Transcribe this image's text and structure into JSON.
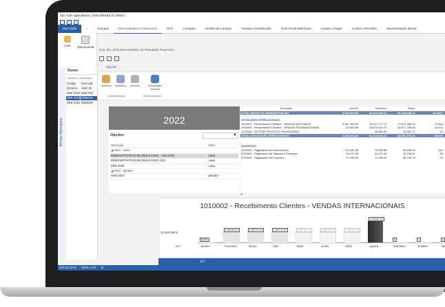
{
  "window": {
    "title": "Ster Soft Applications ( 2022.000165 11.00924 )"
  },
  "menu": {
    "tabs": [
      "SSA 2022",
      "Estoque",
      "Demonstrativos Financeiros",
      "PCP",
      "Compras",
      "Gestão de Cotação",
      "Vendas e Distribuição",
      "Nota Fiscal Eletrônica",
      "Contas a Pagar",
      "Contas a Receber",
      "Movimentação Bancá"
    ],
    "active_index": 2
  },
  "left_ribbon": {
    "livre": "Livre",
    "operacional": "Operacional"
  },
  "navigator": {
    "vertical_label": "Minhas Aplicações",
    "header": "Demo",
    "drag_hint": "Arraste o cabeçalho",
    "columns": [
      "Código",
      "Descriçã"
    ],
    "rows": [
      {
        "code": "2019/AA",
        "desc": "ANO 20"
      },
      {
        "code": "DRE 2020",
        "desc": "DRE 202"
      },
      {
        "code": "DRE 2021",
        "desc": "DEMONI"
      },
      {
        "code": "DRE 2022",
        "desc": "DEMONI"
      }
    ],
    "selected_index": 2
  },
  "document": {
    "title": "[ssa_dre_001]  Demonstrativo de Resultado Financeiro",
    "ribbon_tab": "Opções",
    "buttons": [
      {
        "label": "Acessos",
        "color": "#d9a64a"
      },
      {
        "label": "Histórico",
        "color": "#8aa4cf"
      },
      {
        "label": "Anexos",
        "color": "#b0b0b0"
      },
      {
        "label": "Informação Técnica",
        "color": "#4d7bc6"
      }
    ],
    "groups": [
      "Administração",
      "Desenvolvedor"
    ]
  },
  "year_panel": {
    "year": "2022"
  },
  "opcoes": {
    "title": "Opções",
    "columns": [
      "Descrição",
      "Fator"
    ],
    "groups": [
      {
        "label": "◢  Fator : caixa",
        "rows": [
          {
            "desc": "DEMONSTRATIVO DE RESULTADO - ANO 2022",
            "fator": "caixa"
          },
          {
            "desc": "DEMONSTRATIVO DE RESULTADO 2021",
            "fator": "caixa"
          },
          {
            "desc": "DRE 2020",
            "fator": "caixa"
          }
        ]
      },
      {
        "label": "◢  Fator : gerador",
        "rows": [
          {
            "desc": "ANO 2019",
            "fator": "gerador"
          }
        ]
      }
    ]
  },
  "report": {
    "columns": [
      "Descrição",
      "Janeiro",
      "Fevereiro",
      "Março",
      ""
    ],
    "rows": [
      {
        "type": "total",
        "cells": [
          "TOTAL RECEITAS DEMONSTRAÇÃO",
          "3.436.923,96",
          "92.610.903,11",
          "89.283.638,76",
          "89.260.7"
        ]
      },
      {
        "type": "blank",
        "cells": [
          "",
          "",
          "",
          "",
          ""
        ]
      },
      {
        "type": "sect",
        "cells": [
          "ATIVIDADES OPERACIONAIS",
          "",
          "",
          "",
          ""
        ]
      },
      {
        "type": "row",
        "cells": [
          "1010001 - Recebimento Clientes - VENDAS NACIONAIS",
          "3.357.490,00",
          "76.007.277,74",
          "72.674.288,39",
          "72.654."
        ]
      },
      {
        "type": "row",
        "cells": [
          "1010002 - Recebimento Clientes - VENDAS INTERNACIONAIS",
          "62.063,96",
          "16.574.031,97",
          "16.577.798,68",
          "16.574."
        ]
      },
      {
        "type": "row",
        "cells": [
          "1010005 - OUTRAS RECEITAS FINANCEIRAS",
          "",
          "35.363,40",
          "14.081,70",
          "14."
        ]
      },
      {
        "type": "total",
        "cells": [
          "TOTAL ATIVIDADES OPERACIONAIS",
          "3.420.263,96",
          "92.616.603,11",
          "89.266.978,76",
          "89.243."
        ]
      },
      {
        "type": "blank",
        "cells": [
          "",
          "",
          "",
          "",
          ""
        ]
      },
      {
        "type": "blank",
        "cells": [
          "",
          "",
          "",
          "",
          ""
        ]
      },
      {
        "type": "sect",
        "cells": [
          "DESPESAS",
          "",
          "",
          "",
          ""
        ]
      },
      {
        "type": "row",
        "cells": [
          "2010001 - Pagamento a Fornecedores",
          "175.181,48",
          "73.468,99",
          "43.636,93",
          "164."
        ]
      },
      {
        "type": "row",
        "cells": [
          "2010002 - Pagamento de Salários e Encargos",
          "54.471,48",
          "54.471,48",
          "78.608,87",
          "66."
        ]
      },
      {
        "type": "row",
        "cells": [
          "2010003 - Pagamento de Impostos",
          "71.189,03",
          "71.189,03",
          "36.736,78",
          "12."
        ]
      }
    ]
  },
  "chart_data": {
    "type": "bar",
    "title": "1010002 - Recebimento Clientes - VENDAS INTERNACIONAIS",
    "categories": [
      "Janeiro",
      "Fevereiro",
      "Março",
      "Abril",
      "Maio",
      "Junho",
      "Julho",
      "Agosto",
      "Setembro",
      "Outubro",
      "Novem"
    ],
    "values": [
      62064,
      16574000,
      16577000,
      16577000,
      16574000,
      16574000,
      16574000,
      33949000,
      0,
      0,
      0
    ],
    "data_labels": [
      "62064",
      "1,6574e+07",
      "1,6577e+07",
      "1,6577e+07",
      "1,6574e+07",
      "1,6574e+07",
      "1,6574e+07",
      "3,3949e+07",
      "0",
      "0",
      "0"
    ],
    "yticks": [
      "20.000.000,0",
      "0,0"
    ],
    "ylim": [
      0,
      40000000
    ],
    "highlight_index": 7,
    "footer_value": "137"
  },
  "status": {
    "user": "DULCE DIAS",
    "company": "DIAS e CIA",
    "lang": "pt"
  }
}
